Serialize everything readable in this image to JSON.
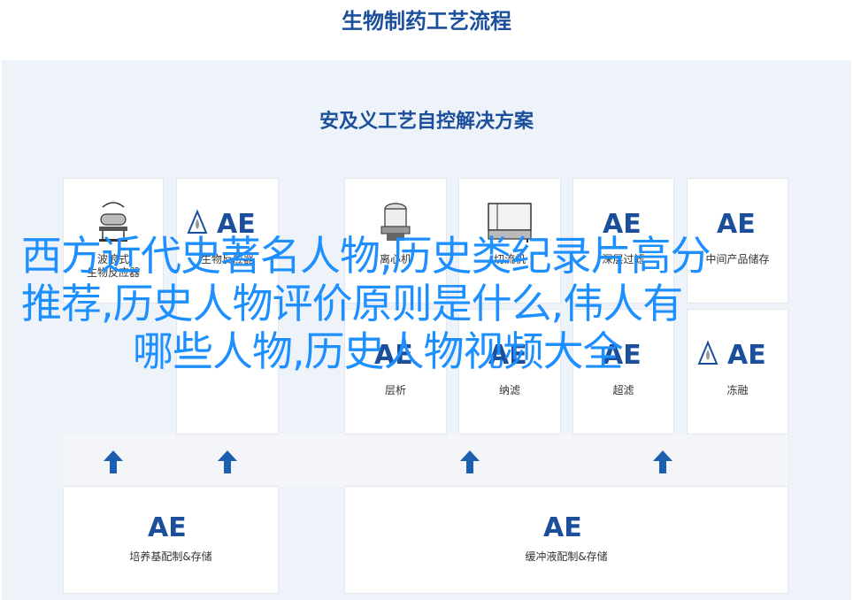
{
  "header": {
    "title": "生物制药工艺流程"
  },
  "diagram": {
    "subtitle": "安及义工艺自控解决方案",
    "brand_mark": "AE",
    "top_cards": [
      {
        "label_line1": "波浪式",
        "label_line2": "生物反应器",
        "icon": "wave-reactor-icon"
      },
      {
        "label_line1": "生物反应器",
        "label_line2": "",
        "icon": "ae-logo-icon"
      },
      {
        "label_line1": "离心机",
        "label_line2": "",
        "icon": "centrifuge-icon"
      },
      {
        "label_line1": "切流机",
        "label_line2": "",
        "icon": "filter-machine-icon"
      },
      {
        "label_line1": "深层过滤",
        "label_line2": "",
        "icon": "ae-logo-icon"
      },
      {
        "label_line1": "中间产品储存",
        "label_line2": "",
        "icon": "ae-logo-icon"
      }
    ],
    "mid_cards": [
      {
        "label": "层析"
      },
      {
        "label": "纳滤"
      },
      {
        "label": "超滤"
      },
      {
        "label": "冻融"
      }
    ],
    "bottom_cards": [
      {
        "label": "培养基配制&存储"
      },
      {
        "label": "缓冲液配制&存储"
      }
    ]
  },
  "overlay": {
    "line1": "西方近代史著名人物,历史类纪录片高分",
    "line2": "推荐,历史人物评价原则是什么,伟人有",
    "line3": "哪些人物,历史人物视频大全"
  },
  "colors": {
    "brand": "#1b4f9c",
    "overlay": "#1e8fff",
    "arrow": "#1b5fb0"
  }
}
